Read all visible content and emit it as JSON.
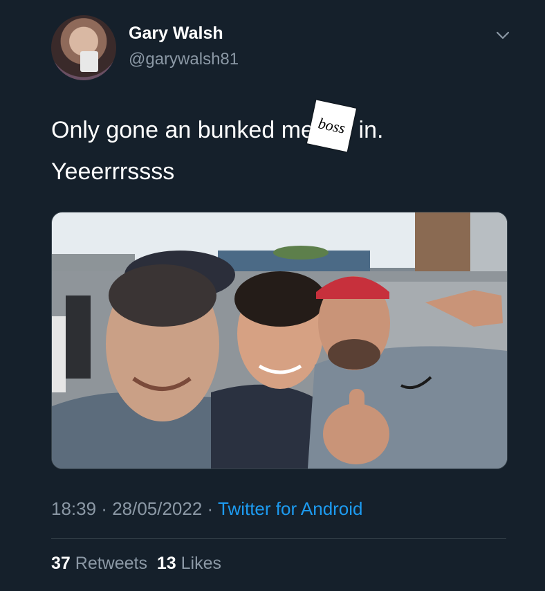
{
  "user": {
    "name": "Gary Walsh",
    "handle": "@garywalsh81"
  },
  "tweet": {
    "text_line1_before": "Only gone an bunked me",
    "sticker_text": "boss",
    "text_line1_after": " in.",
    "text_line2": "Yeeerrrssss"
  },
  "meta": {
    "time": "18:39",
    "separator": " · ",
    "date": "28/05/2022",
    "client": "Twitter for Android"
  },
  "stats": {
    "retweets_count": "37",
    "retweets_label": "Retweets",
    "likes_count": "13",
    "likes_label": "Likes"
  },
  "icons": {
    "more": "chevron-down-icon"
  },
  "colors": {
    "background": "#15202b",
    "link": "#1d9bf0",
    "secondary_text": "#8b98a5"
  }
}
